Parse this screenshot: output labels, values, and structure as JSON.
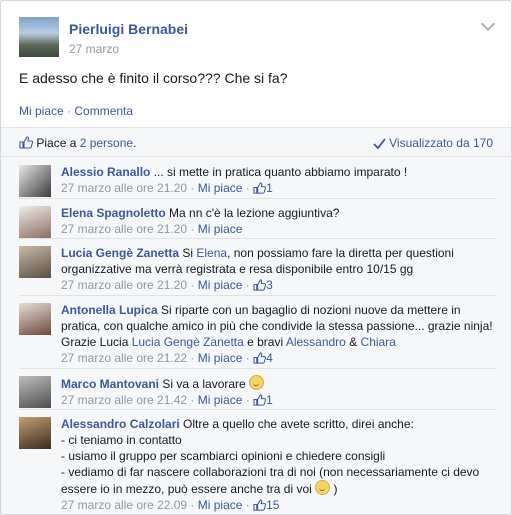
{
  "post": {
    "author": "Pierluigi Bernabei",
    "date": "27 marzo",
    "text": "E adesso che è finito il corso??? Che si fa?",
    "action_like": "Mi piace",
    "action_sep": "·",
    "action_comment": "Commenta"
  },
  "stats": {
    "likes_prefix": "Piace a ",
    "likes_link": "2 persone",
    "likes_suffix": ".",
    "seen": "Visualizzato da 170"
  },
  "comments": [
    {
      "name": "Alessio Ranallo",
      "text": " ... si mette in pratica quanto abbiamo imparato !",
      "time": "27 marzo alle ore 21.20",
      "like": "Mi piace",
      "count": "1"
    },
    {
      "name": "Elena Spagnoletto",
      "text": " Ma nn c'è la lezione aggiuntiva?",
      "time": "27 marzo alle ore 21.20",
      "like": "Mi piace"
    },
    {
      "name": "Lucia Gengè Zanetta",
      "text_a": " Si ",
      "link_a": "Elena",
      "text_b": ", non possiamo fare la diretta per questioni organizzative ma verrà registrata e resa disponibile entro 10/15 gg",
      "time": "27 marzo alle ore 21.20",
      "like": "Mi piace",
      "count": "3"
    },
    {
      "name": "Antonella Lupica",
      "text_a": " Si riparte con un bagaglio di nozioni nuove da mettere in pratica, con qualche amico in più che condivide la stessa passione... grazie ninja! Grazie Lucia ",
      "link_a": "Lucia Gengè Zanetta",
      "text_b": " e bravi ",
      "link_b": "Alessandro",
      "text_c": " & ",
      "link_c": "Chiara",
      "time": "27 marzo alle ore 21.22",
      "like": "Mi piace",
      "count": "4"
    },
    {
      "name": "Marco Mantovani",
      "text": " Si va a lavorare ",
      "time": "27 marzo alle ore 21.42",
      "like": "Mi piace",
      "count": "1"
    },
    {
      "name": "Alessandro Calzolari",
      "text_a": " Oltre a quello che avete scritto, direi anche:",
      "line1": "- ci teniamo in contatto",
      "line2": "- usiamo il gruppo per scambiarci opinioni e chiedere consigli",
      "line3": "- vediamo di far nascere collaborazioni tra di noi (non necessariamente ci devo essere io in mezzo, può essere anche tra di voi ",
      "line3_end": " )",
      "time": "27 marzo alle ore 22.09",
      "like": "Mi piace",
      "count": "15"
    }
  ],
  "meta_sep": " · ",
  "colors": {
    "link": "#3b5998",
    "muted": "#9197a3",
    "bg": "#f6f7f8"
  }
}
